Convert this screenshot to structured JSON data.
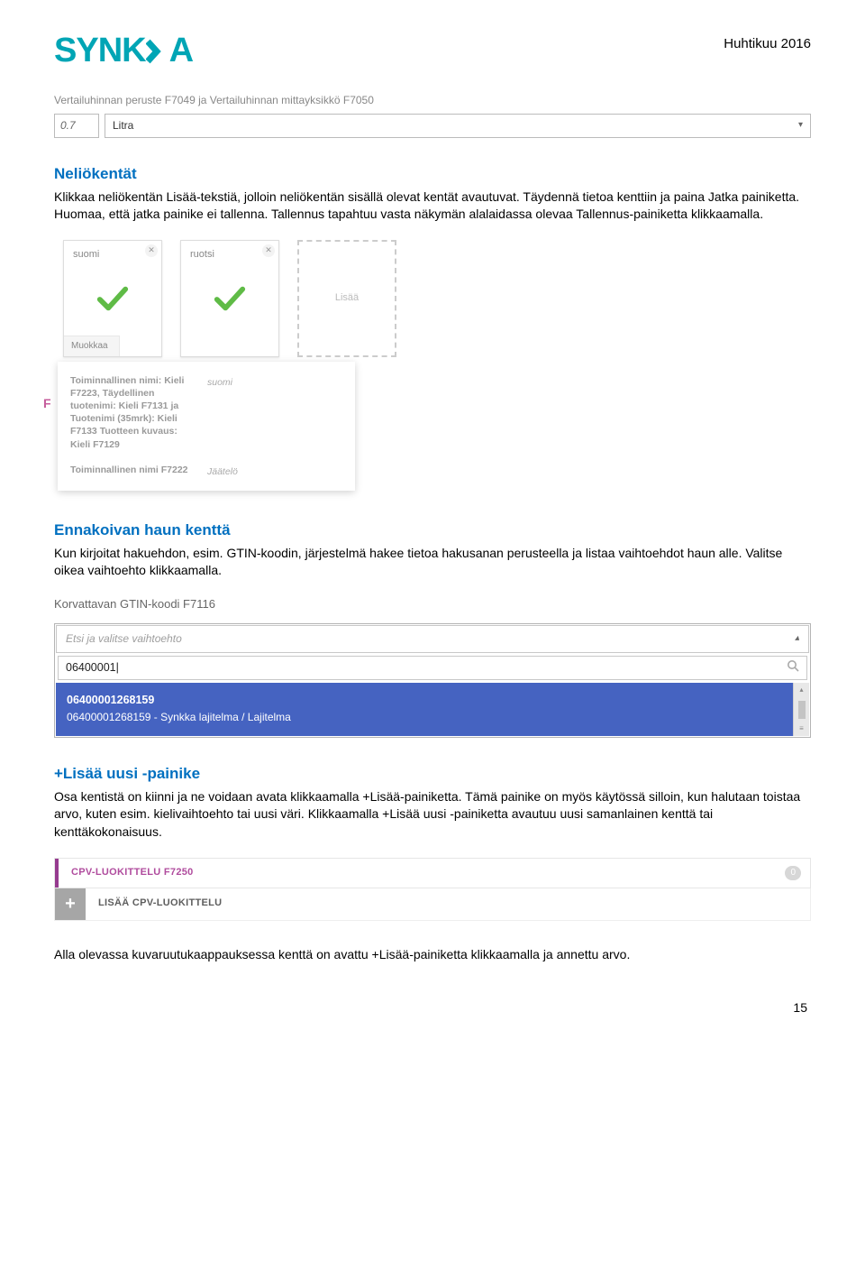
{
  "header": {
    "brand": "SYNKKA",
    "date": "Huhtikuu 2016"
  },
  "combo": {
    "label": "Vertailuhinnan peruste F7049 ja Vertailuhinnan mittayksikkö F7050",
    "value": "0.7",
    "selected": "Litra"
  },
  "section1": {
    "heading": "Neliökentät",
    "body": "Klikkaa neliökentän Lisää-tekstiä, jolloin neliökentän sisällä olevat kentät avautuvat. Täydennä tietoa kenttiin ja paina Jatka painiketta. Huomaa, että jatka painike ei tallenna. Tallennus tapahtuu vasta näkymän alalaidassa olevaa Tallennus-painiketta klikkaamalla."
  },
  "cards": {
    "card1": {
      "title": "suomi",
      "edit": "Muokkaa"
    },
    "card2": {
      "title": "ruotsi"
    },
    "addLabel": "Lisää",
    "detail": {
      "label1": "Toiminnallinen nimi: Kieli F7223, Täydellinen tuotenimi: Kieli F7131 ja Tuotenimi (35mrk): Kieli F7133 Tuotteen kuvaus: Kieli F7129",
      "val1": "suomi",
      "label2": "Toiminnallinen nimi F7222",
      "val2": "Jäätelö"
    }
  },
  "section2": {
    "heading": "Ennakoivan haun kenttä",
    "body": "Kun kirjoitat hakuehdon, esim. GTIN-koodin, järjestelmä hakee tietoa hakusanan perusteella ja listaa vaihtoehdot haun alle. Valitse oikea vaihtoehto klikkaamalla."
  },
  "search": {
    "title": "Korvattavan GTIN-koodi F7116",
    "placeholder": "Etsi ja valitse vaihtoehto",
    "value": "06400001",
    "result_title": "06400001268159",
    "result_desc": "06400001268159 - Synkka lajitelma / Lajitelma"
  },
  "section3": {
    "heading": "+Lisää uusi -painike",
    "body": "Osa kentistä on kiinni ja ne voidaan avata klikkaamalla +Lisää-painiketta. Tämä painike on myös käytössä silloin, kun halutaan toistaa arvo, kuten esim. kielivaihtoehto tai uusi väri. Klikkaamalla +Lisää uusi -painiketta avautuu uusi samanlainen kenttä tai kenttäkokonaisuus."
  },
  "cpv": {
    "title": "CPV-LUOKITTELU F7250",
    "badge": "0",
    "add": "LISÄÄ CPV-LUOKITTELU",
    "plus": "+"
  },
  "footer_text": "Alla olevassa kuvaruutukaappauksessa kenttä on avattu +Lisää-painiketta klikkaamalla ja annettu arvo.",
  "page_number": "15"
}
